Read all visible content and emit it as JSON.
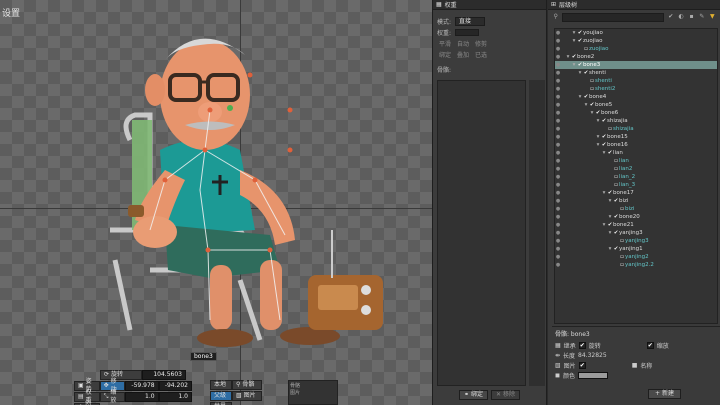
{
  "viewport": {
    "title": "设置",
    "selected_bone_label": "bone3",
    "toolbar": {
      "rotate": {
        "label": "旋转",
        "value": "104.5603"
      },
      "translate": {
        "label": "移动",
        "x": "-59.978",
        "y": "-94.202"
      },
      "scale": {
        "label": "缩放",
        "x": "1.0",
        "y": "1.0"
      },
      "left_buttons": [
        "姿势",
        "权重",
        "创建"
      ],
      "mid_buttons": [
        "本地",
        "父级",
        "世界"
      ],
      "bone_btn": "骨骼",
      "image_btn": "图片",
      "mini_panel": [
        "骨骼",
        "图片"
      ]
    }
  },
  "middle": {
    "tab_title": "权重",
    "mode_label": "模式:",
    "mode_value": "直接",
    "weight_label": "权重:",
    "row_buttons_1": [
      "平滑",
      "自动",
      "修剪"
    ],
    "row_buttons_2": [
      "绑定",
      "叠加",
      "已选"
    ],
    "bones_label": "骨骼:",
    "footer_bind": "绑定",
    "footer_remove": "移除"
  },
  "right": {
    "tab_title": "层级树",
    "tree": [
      {
        "depth": 6,
        "name": "youjiao",
        "type": "bone"
      },
      {
        "depth": 6,
        "name": "zuojiao",
        "type": "bone"
      },
      {
        "depth": 7,
        "name": "zuojiao",
        "type": "att"
      },
      {
        "depth": 5,
        "name": "bone2",
        "type": "bone"
      },
      {
        "depth": 6,
        "name": "bone3",
        "type": "bone",
        "selected": true
      },
      {
        "depth": 7,
        "name": "shenti",
        "type": "bone"
      },
      {
        "depth": 8,
        "name": "shenti",
        "type": "att"
      },
      {
        "depth": 8,
        "name": "shenti2",
        "type": "att"
      },
      {
        "depth": 7,
        "name": "bone4",
        "type": "bone"
      },
      {
        "depth": 8,
        "name": "bone5",
        "type": "bone"
      },
      {
        "depth": 9,
        "name": "bone6",
        "type": "bone"
      },
      {
        "depth": 10,
        "name": "shizajia",
        "type": "bone"
      },
      {
        "depth": 11,
        "name": "shizajia",
        "type": "att"
      },
      {
        "depth": 10,
        "name": "bone15",
        "type": "bone"
      },
      {
        "depth": 10,
        "name": "bone16",
        "type": "bone"
      },
      {
        "depth": 11,
        "name": "lian",
        "type": "bone"
      },
      {
        "depth": 12,
        "name": "lian",
        "type": "att"
      },
      {
        "depth": 12,
        "name": "lian2",
        "type": "att"
      },
      {
        "depth": 12,
        "name": "lian_2",
        "type": "att"
      },
      {
        "depth": 12,
        "name": "lian_3",
        "type": "att"
      },
      {
        "depth": 11,
        "name": "bone17",
        "type": "bone"
      },
      {
        "depth": 12,
        "name": "bizi",
        "type": "bone"
      },
      {
        "depth": 13,
        "name": "bizi",
        "type": "att"
      },
      {
        "depth": 12,
        "name": "bone20",
        "type": "bone"
      },
      {
        "depth": 11,
        "name": "bone21",
        "type": "bone"
      },
      {
        "depth": 12,
        "name": "yanjing3",
        "type": "bone"
      },
      {
        "depth": 13,
        "name": "yanjing3",
        "type": "att"
      },
      {
        "depth": 12,
        "name": "yanjing1",
        "type": "bone"
      },
      {
        "depth": 13,
        "name": "yanjing2",
        "type": "att"
      },
      {
        "depth": 13,
        "name": "yanjing2.2",
        "type": "att"
      }
    ],
    "props": {
      "title": "骨骼: bone3",
      "inherit_label": "继承",
      "rotate_label": "旋转",
      "scale_label": "缩放",
      "length_label": "长度",
      "length_value": "84.32825",
      "image_label": "图片",
      "name_label": "名称",
      "color_label": "颜色",
      "new_button": "新建"
    }
  }
}
